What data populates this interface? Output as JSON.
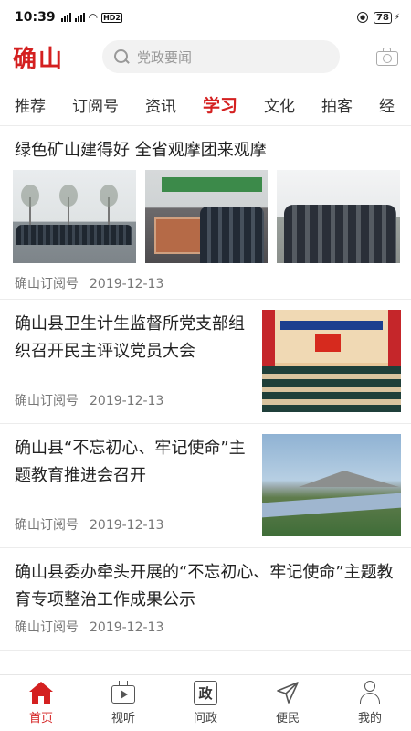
{
  "status_bar": {
    "time": "10:39",
    "network": "HD2",
    "battery": "78"
  },
  "header": {
    "logo": "确山",
    "search_placeholder": "党政要闻"
  },
  "tabs": [
    {
      "label": "推荐",
      "active": false
    },
    {
      "label": "订阅号",
      "active": false
    },
    {
      "label": "资讯",
      "active": false
    },
    {
      "label": "学习",
      "active": true
    },
    {
      "label": "文化",
      "active": false
    },
    {
      "label": "拍客",
      "active": false
    },
    {
      "label": "经",
      "active": false
    }
  ],
  "articles": [
    {
      "title": "绿色矿山建得好 全省观摩团来观摩",
      "source": "确山订阅号",
      "date": "2019-12-13",
      "layout": "three-images"
    },
    {
      "title": "确山县卫生计生监督所党支部组织召开民主评议党员大会",
      "source": "确山订阅号",
      "date": "2019-12-13",
      "layout": "side-image"
    },
    {
      "title": " 确山县“不忘初心、牢记使命”主题教育推进会召开",
      "source": "确山订阅号",
      "date": "2019-12-13",
      "layout": "side-image"
    },
    {
      "title": " 确山县委办牵头开展的“不忘初心、牢记使命”主题教育专项整治工作成果公示",
      "source": "确山订阅号",
      "date": "2019-12-13",
      "layout": "text-only"
    }
  ],
  "bottom_nav": [
    {
      "label": "首页",
      "icon": "home-icon",
      "active": true
    },
    {
      "label": "视听",
      "icon": "tv-icon",
      "active": false
    },
    {
      "label": "问政",
      "icon": "zheng-icon",
      "icon_text": "政",
      "active": false
    },
    {
      "label": "便民",
      "icon": "send-icon",
      "active": false
    },
    {
      "label": "我的",
      "icon": "person-icon",
      "active": false
    }
  ],
  "colors": {
    "accent": "#d42020",
    "text": "#222222",
    "meta": "#777777"
  }
}
